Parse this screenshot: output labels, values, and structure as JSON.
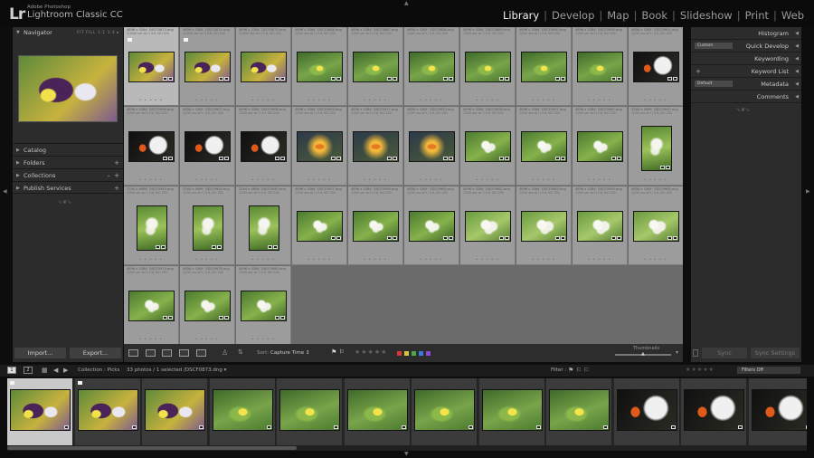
{
  "app": {
    "logo": "Lr",
    "brand_line1": "Adobe Photoshop",
    "brand_line2": "Lightroom Classic CC"
  },
  "modules": [
    {
      "label": "Library",
      "active": true
    },
    {
      "label": "Develop"
    },
    {
      "label": "Map"
    },
    {
      "label": "Book"
    },
    {
      "label": "Slideshow"
    },
    {
      "label": "Print"
    },
    {
      "label": "Web"
    }
  ],
  "left": {
    "navigator": "Navigator",
    "nav_options": "FIT   FILL   1:1   1:4 ▸",
    "sections": [
      "Catalog",
      "Folders",
      "Collections",
      "Publish Services"
    ],
    "import": "Import...",
    "export": "Export..."
  },
  "right": {
    "panels": [
      "Histogram",
      "Quick Develop",
      "Keyword List",
      "Keywording",
      "Metadata",
      "Comments"
    ],
    "quick_develop_preset": "Custom",
    "metadata_preset": "Default",
    "sync": "Sync",
    "sync_settings": "Sync Settings"
  },
  "toolbar": {
    "sort_label": "Sort:",
    "sort_value": "Capture Time ↕",
    "thumbnails": "Thumbnails",
    "stars": "★★★★★",
    "label_colors": [
      "#d43a3a",
      "#d8c43a",
      "#4aa84a",
      "#3a7ad8",
      "#8a4ad8"
    ]
  },
  "grid": [
    {
      "dims": "4896 x 3264",
      "file": "DSCF0873.dng",
      "info": "1/1000 sec at f / 5.6, ISO 200",
      "photo": "pansy",
      "orient": "h",
      "selected": true,
      "flag": true
    },
    {
      "dims": "4896 x 3264",
      "file": "DSCF0874.dng",
      "info": "1/1000 sec at f / 5.6, ISO 200",
      "photo": "pansy",
      "orient": "h",
      "flag": true
    },
    {
      "dims": "4896 x 3264",
      "file": "DSCF0875.dng",
      "info": "1/1000 sec at f / 5.6, ISO 200",
      "photo": "pansy",
      "orient": "h"
    },
    {
      "dims": "4896 x 3264",
      "file": "DSCF0886.dng",
      "info": "1/500 sec at f / 5.6, ISO 200",
      "photo": "yellow",
      "orient": "h"
    },
    {
      "dims": "4896 x 3264",
      "file": "DSCF0887.dng",
      "info": "1/500 sec at f / 5.6, ISO 200",
      "photo": "yellow",
      "orient": "h"
    },
    {
      "dims": "4896 x 3264",
      "file": "DSCF0888.dng",
      "info": "1/500 sec at f / 5.6, ISO 200",
      "photo": "yellow",
      "orient": "h"
    },
    {
      "dims": "4896 x 3264",
      "file": "DSCF0889.dng",
      "info": "1/500 sec at f / 5.6, ISO 200",
      "photo": "yellow",
      "orient": "h"
    },
    {
      "dims": "4896 x 3264",
      "file": "DSCF0890.dng",
      "info": "1/500 sec at f / 5.6, ISO 200",
      "photo": "yellow",
      "orient": "h"
    },
    {
      "dims": "4896 x 3264",
      "file": "DSCF0894.dng",
      "info": "1/500 sec at f / 5.6, ISO 200",
      "photo": "yellow",
      "orient": "h"
    },
    {
      "dims": "4896 x 3264",
      "file": "DSCF0901.dng",
      "info": "1/250 sec at f / 4.0, ISO 200",
      "photo": "orchid",
      "orient": "h"
    },
    {
      "dims": "4896 x 3264",
      "file": "DSCF0906.dng",
      "info": "1/250 sec at f / 4.0, ISO 200",
      "photo": "orchid",
      "orient": "h"
    },
    {
      "dims": "4896 x 3264",
      "file": "DSCF0907.dng",
      "info": "1/250 sec at f / 4.0, ISO 200",
      "photo": "orchid",
      "orient": "h"
    },
    {
      "dims": "4896 x 3264",
      "file": "DSCF0908.dng",
      "info": "1/250 sec at f / 4.0, ISO 200",
      "photo": "orchid",
      "orient": "h"
    },
    {
      "dims": "4896 x 3264",
      "file": "DSCF0909.dng",
      "info": "1/320 sec at f / 5.6, ISO 200",
      "photo": "daisy",
      "orient": "h"
    },
    {
      "dims": "4896 x 3264",
      "file": "DSCF0911.dng",
      "info": "1/320 sec at f / 5.6, ISO 200",
      "photo": "daisy",
      "orient": "h"
    },
    {
      "dims": "4896 x 3264",
      "file": "DSCF0953.dng",
      "info": "1/320 sec at f / 5.6, ISO 200",
      "photo": "daisy",
      "orient": "h"
    },
    {
      "dims": "4896 x 3264",
      "file": "DSCF0956.dng",
      "info": "1/250 sec at f / 5.6, ISO 200",
      "photo": "white",
      "orient": "h"
    },
    {
      "dims": "4896 x 3264",
      "file": "DSCF0957.dng",
      "info": "1/250 sec at f / 5.6, ISO 200",
      "photo": "white",
      "orient": "h"
    },
    {
      "dims": "4896 x 3264",
      "file": "DSCF0961.dng",
      "info": "1/250 sec at f / 5.6, ISO 200",
      "photo": "white",
      "orient": "h"
    },
    {
      "dims": "3264 x 4896",
      "file": "DSCF0942.dng",
      "info": "1/250 sec at f / 5.6, ISO 200",
      "photo": "whitev",
      "orient": "v"
    },
    {
      "dims": "3264 x 4896",
      "file": "DSCF0943.dng",
      "info": "1/250 sec at f / 5.6, ISO 200",
      "photo": "whitev",
      "orient": "v"
    },
    {
      "dims": "3264 x 4896",
      "file": "DSCF0944.dng",
      "info": "1/250 sec at f / 5.6, ISO 200",
      "photo": "whitev",
      "orient": "v"
    },
    {
      "dims": "3264 x 4896",
      "file": "DSCF0945.dng",
      "info": "1/250 sec at f / 5.6, ISO 200",
      "photo": "whitev",
      "orient": "v"
    },
    {
      "dims": "4896 x 3264",
      "file": "DSCF0957.dng",
      "info": "1/250 sec at f / 5.6, ISO 200",
      "photo": "white",
      "orient": "h"
    },
    {
      "dims": "4896 x 3264",
      "file": "DSCF0958.dng",
      "info": "1/250 sec at f / 5.6, ISO 200",
      "photo": "white",
      "orient": "h"
    },
    {
      "dims": "4896 x 3264",
      "file": "DSCF0960.dng",
      "info": "1/250 sec at f / 5.6, ISO 200",
      "photo": "white",
      "orient": "h"
    },
    {
      "dims": "4896 x 3264",
      "file": "DSCF0962.dng",
      "info": "1/250 sec at f / 5.6, ISO 200",
      "photo": "whitebig",
      "orient": "h"
    },
    {
      "dims": "4896 x 3264",
      "file": "DSCF0963.dng",
      "info": "1/250 sec at f / 5.6, ISO 200",
      "photo": "whitebig",
      "orient": "h"
    },
    {
      "dims": "4896 x 3264",
      "file": "DSCF0964.dng",
      "info": "1/250 sec at f / 5.6, ISO 200",
      "photo": "whitebig",
      "orient": "h"
    },
    {
      "dims": "4896 x 3264",
      "file": "DSCF0965.dng",
      "info": "1/250 sec at f / 5.6, ISO 200",
      "photo": "whitebig",
      "orient": "h"
    },
    {
      "dims": "4896 x 3264",
      "file": "DSCF0973.dng",
      "info": "1/250 sec at f / 5.6, ISO 200",
      "photo": "white",
      "orient": "h"
    },
    {
      "dims": "4896 x 3264",
      "file": "DSCF0978.dng",
      "info": "1/250 sec at f / 5.6, ISO 200",
      "photo": "white",
      "orient": "h"
    },
    {
      "dims": "4896 x 3264",
      "file": "DSCF0980.dng",
      "info": "1/250 sec at f / 5.6, ISO 200",
      "photo": "white",
      "orient": "h"
    }
  ],
  "filmbar": {
    "page1": "1",
    "page2": "2",
    "source": "Collection : Picks",
    "count": "33 photos / 1 selected /DSCF0873.dng ▾",
    "filter_label": "Filter :",
    "filter_value": "Filters Off"
  },
  "filmstrip": [
    "pansy",
    "pansy",
    "pansy",
    "yellow",
    "yellow",
    "yellow",
    "yellow",
    "yellow",
    "yellow",
    "orchid",
    "orchid",
    "orchid"
  ]
}
